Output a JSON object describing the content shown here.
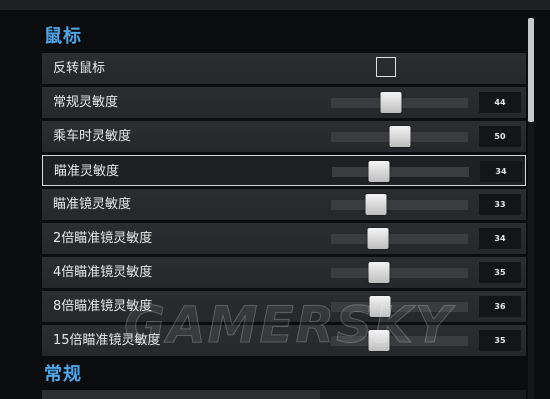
{
  "sections": {
    "mouse": "鼠标",
    "general": "常规"
  },
  "settings": [
    {
      "label": "反转鼠标",
      "type": "checkbox",
      "checked": false
    },
    {
      "label": "常规灵敏度",
      "type": "slider",
      "value": "44",
      "level": 0.44
    },
    {
      "label": "乘车时灵敏度",
      "type": "slider",
      "value": "50",
      "level": 0.5
    },
    {
      "label": "瞄准灵敏度",
      "type": "slider",
      "value": "34",
      "level": 0.34,
      "selected": true
    },
    {
      "label": "瞄准镜灵敏度",
      "type": "slider",
      "value": "33",
      "level": 0.33
    },
    {
      "label": "2倍瞄准镜灵敏度",
      "type": "slider",
      "value": "34",
      "level": 0.34
    },
    {
      "label": "4倍瞄准镜灵敏度",
      "type": "slider",
      "value": "35",
      "level": 0.35
    },
    {
      "label": "8倍瞄准镜灵敏度",
      "type": "slider",
      "value": "36",
      "level": 0.36
    },
    {
      "label": "15倍瞄准镜灵敏度",
      "type": "slider",
      "value": "35",
      "level": 0.35
    }
  ],
  "watermark": "GAMERSKY",
  "colors": {
    "section_title": "#4fa6e8",
    "row_bg": "#2b2d31",
    "background": "#0b0c0e"
  }
}
